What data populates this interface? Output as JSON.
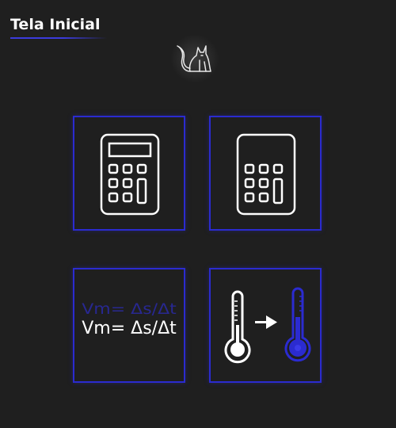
{
  "header": {
    "title": "Tela Inicial"
  },
  "logo": {
    "icon": "cat-icon"
  },
  "tiles": [
    {
      "icon": "calculator-icon"
    },
    {
      "icon": "calculator-simple-icon"
    },
    {
      "icon": "average-speed-formula",
      "formula": "Vm= Δs/Δt"
    },
    {
      "icon": "temperature-converter-icon"
    }
  ],
  "colors": {
    "background": "#1f1f1f",
    "accent": "#2b2bd0",
    "foreground": "#ffffff"
  }
}
